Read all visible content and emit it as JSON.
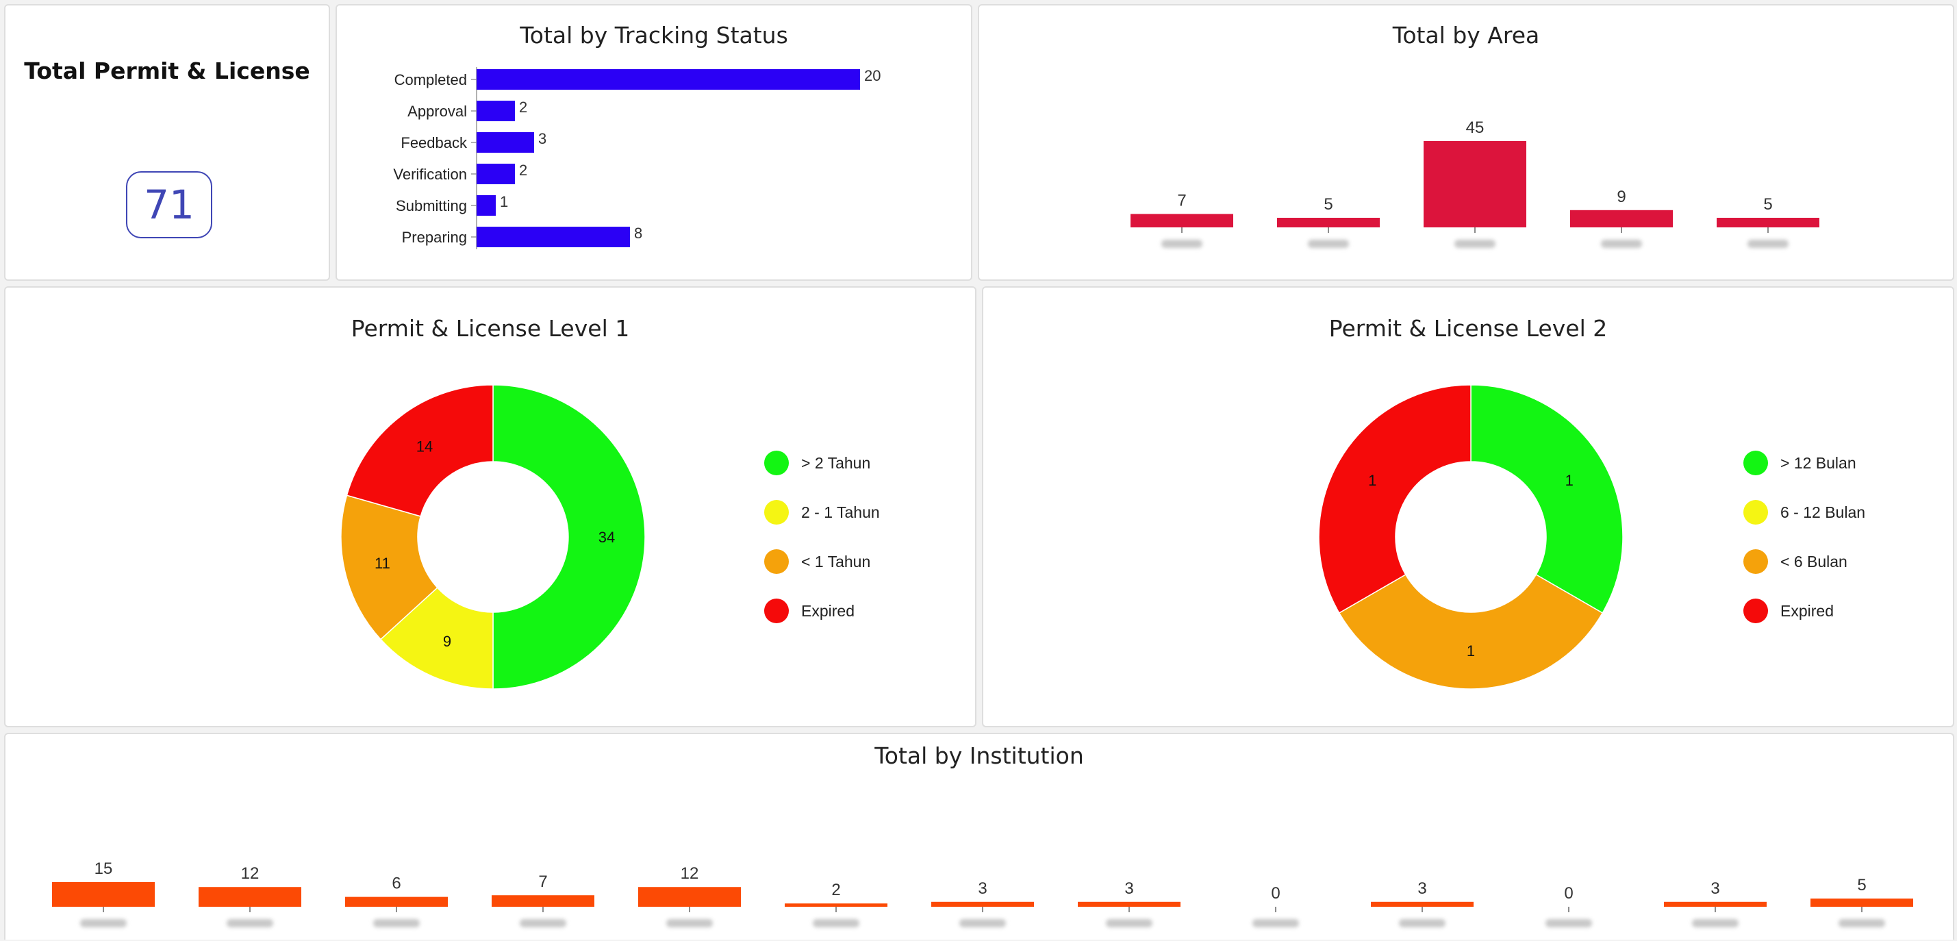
{
  "total_card": {
    "title": "Total Permit & License",
    "value": "71"
  },
  "tracking": {
    "title": "Total by Tracking Status"
  },
  "area": {
    "title": "Total by Area"
  },
  "level1": {
    "title": "Permit & License Level 1",
    "legend": [
      {
        "label": "> 2 Tahun",
        "color": "#13f513"
      },
      {
        "label": "2 - 1 Tahun",
        "color": "#f5f513"
      },
      {
        "label": "< 1 Tahun",
        "color": "#f5a20b"
      },
      {
        "label": "Expired",
        "color": "#f50a0a"
      }
    ]
  },
  "level2": {
    "title": "Permit & License Level 2",
    "legend": [
      {
        "label": "> 12 Bulan",
        "color": "#13f513"
      },
      {
        "label": "6 - 12 Bulan",
        "color": "#f5f513"
      },
      {
        "label": "< 6 Bulan",
        "color": "#f5a20b"
      },
      {
        "label": "Expired",
        "color": "#f50a0a"
      }
    ]
  },
  "institution": {
    "title": "Total by Institution"
  },
  "chart_data": [
    {
      "type": "bar",
      "orientation": "horizontal",
      "title": "Total by Tracking Status",
      "categories": [
        "Completed",
        "Approval",
        "Feedback",
        "Verification",
        "Submitting",
        "Preparing"
      ],
      "values": [
        20,
        2,
        3,
        2,
        1,
        8
      ],
      "color": "#2b00f5"
    },
    {
      "type": "bar",
      "title": "Total by Area",
      "categories": [
        "",
        "",
        "",
        "",
        ""
      ],
      "values": [
        7,
        5,
        45,
        9,
        5
      ],
      "color": "#dc143c"
    },
    {
      "type": "pie",
      "title": "Permit & License Level 1",
      "categories": [
        "> 2 Tahun",
        "2 - 1 Tahun",
        "< 1 Tahun",
        "Expired"
      ],
      "values": [
        34,
        9,
        11,
        14
      ],
      "colors": [
        "#13f513",
        "#f5f513",
        "#f5a20b",
        "#f50a0a"
      ]
    },
    {
      "type": "pie",
      "title": "Permit & License Level 2",
      "categories": [
        "> 12 Bulan",
        "6 - 12 Bulan",
        "< 6 Bulan",
        "Expired"
      ],
      "values": [
        1,
        0,
        1,
        1
      ],
      "colors": [
        "#13f513",
        "#f5f513",
        "#f5a20b",
        "#f50a0a"
      ]
    },
    {
      "type": "bar",
      "title": "Total by Institution",
      "categories": [
        "",
        "",
        "",
        "",
        "",
        "",
        "",
        "",
        "",
        "",
        "",
        "",
        ""
      ],
      "values": [
        15,
        12,
        6,
        7,
        12,
        2,
        3,
        3,
        0,
        3,
        0,
        3,
        5
      ],
      "color": "#fc4a05"
    }
  ]
}
